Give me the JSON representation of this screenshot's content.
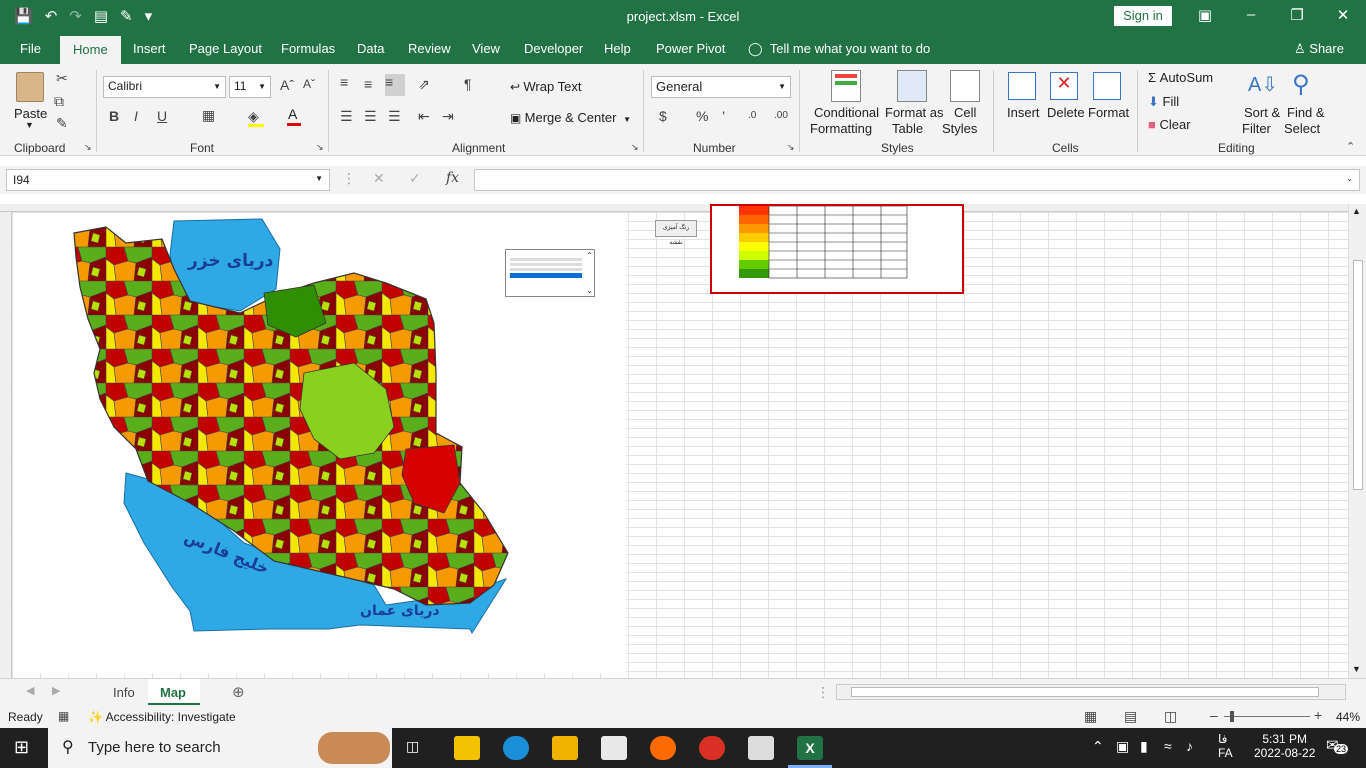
{
  "window": {
    "title": "project.xlsm  -  Excel",
    "sign_in": "Sign in"
  },
  "tabs": [
    "File",
    "Home",
    "Insert",
    "Page Layout",
    "Formulas",
    "Data",
    "Review",
    "View",
    "Developer",
    "Help",
    "Power Pivot"
  ],
  "tell_me": "Tell me what you want to do",
  "share": "Share",
  "ribbon": {
    "clipboard": {
      "label": "Clipboard",
      "paste": "Paste"
    },
    "font": {
      "label": "Font",
      "name": "Calibri",
      "size": "11"
    },
    "alignment": {
      "label": "Alignment",
      "wrap": "Wrap Text",
      "merge": "Merge & Center"
    },
    "number": {
      "label": "Number",
      "format": "General"
    },
    "styles": {
      "label": "Styles",
      "cond1": "Conditional",
      "cond2": "Formatting",
      "fmt1": "Format as",
      "fmt2": "Table",
      "cell1": "Cell",
      "cell2": "Styles"
    },
    "cells": {
      "label": "Cells",
      "insert": "Insert",
      "delete": "Delete",
      "format": "Format"
    },
    "editing": {
      "label": "Editing",
      "autosum": "AutoSum",
      "fill": "Fill",
      "clear": "Clear",
      "sort1": "Sort &",
      "sort2": "Filter",
      "find1": "Find &",
      "find2": "Select"
    }
  },
  "formula_bar": {
    "cell": "I94",
    "fx": "fx",
    "value": ""
  },
  "map": {
    "caspian": "دریای خزر",
    "gulf": "خلیج فارس",
    "oman": "دریای عمان",
    "button": "رنگ آمیزی نقشه"
  },
  "colors": {
    "excel_green": "#217346",
    "sea": "#2fa8e6"
  },
  "sheets": [
    "Info",
    "Map"
  ],
  "status": {
    "ready": "Ready",
    "accessibility": "Accessibility: Investigate",
    "zoom": "44%"
  },
  "taskbar": {
    "search": "Type here to search",
    "lang1": "فا",
    "lang2": "FA",
    "time": "5:31 PM",
    "date": "2022-08-22",
    "notif": "23"
  }
}
